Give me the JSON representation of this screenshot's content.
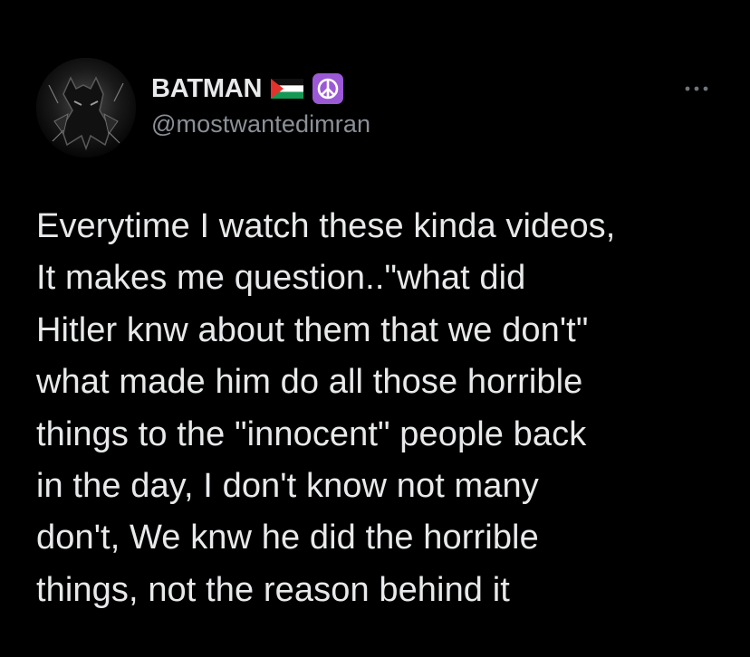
{
  "tweet": {
    "author": {
      "display_name": "BATMAN",
      "handle": "@mostwantedimran",
      "badges": [
        "palestine-flag-icon",
        "peace-symbol-icon"
      ]
    },
    "more_icon": "ellipsis-icon",
    "text": "Everytime I watch these kinda videos,\nIt makes me question..\"what did\nHitler knw about them that we don't\"\nwhat made him do all those horrible\nthings to the \"innocent\" people back\nin the day, I don't know not many\ndon't, We knw he did the horrible\nthings, not the reason behind it"
  },
  "colors": {
    "background": "#000000",
    "text_primary": "#e7e9ea",
    "text_secondary": "#8b9097",
    "peace_badge": "#9b59d6"
  }
}
